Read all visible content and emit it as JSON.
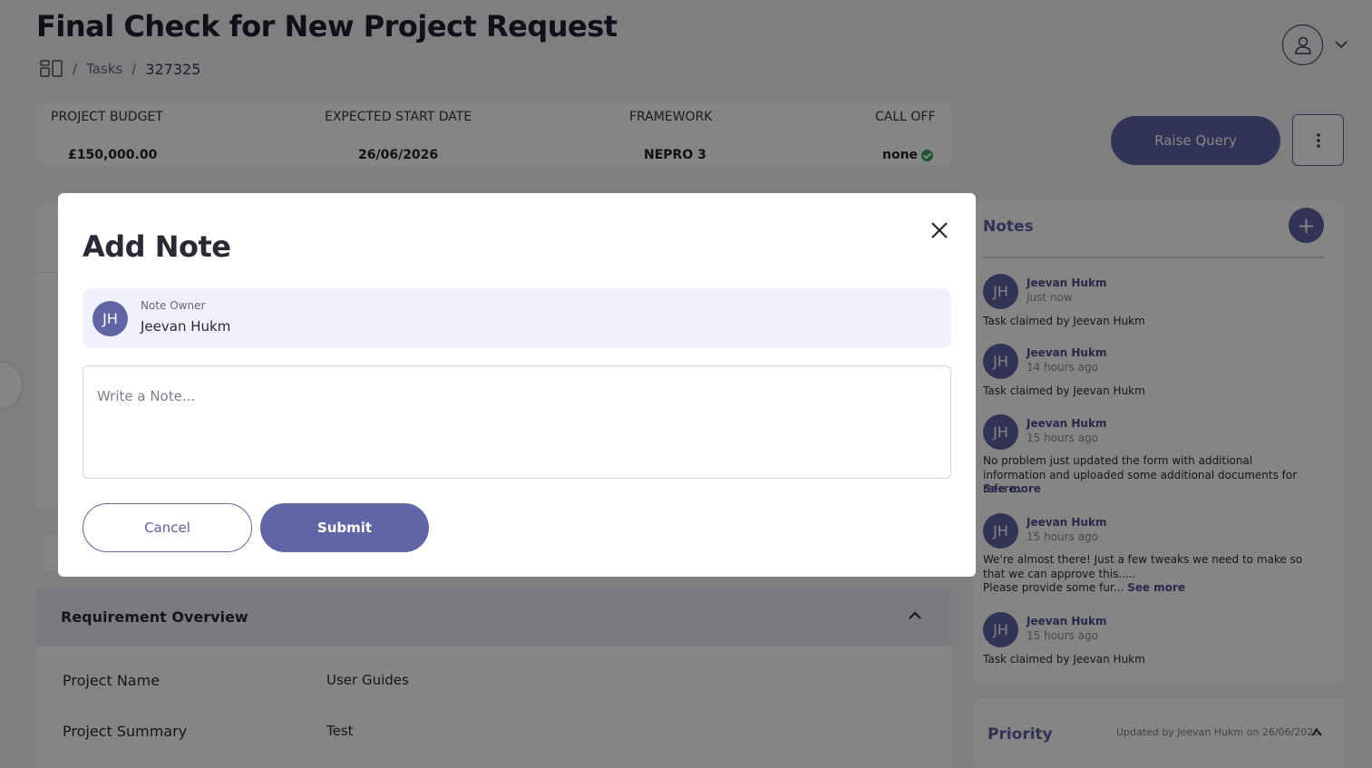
{
  "page": {
    "title": "Final Check for New Project Request",
    "breadcrumb": {
      "home_icon": "dashboard-icon",
      "separator": "/",
      "tasks": "Tasks",
      "id": "327325"
    }
  },
  "header": {
    "profile_icon": "user-icon",
    "menu_icon": "chevron-down-icon"
  },
  "summary": {
    "budget_label": "PROJECT BUDGET",
    "budget_value": "£150,000.00",
    "start_label": "EXPECTED START DATE",
    "start_value": "26/06/2026",
    "framework_label": "FRAMEWORK",
    "framework_value": "NEPRO 3",
    "calloff_label": "CALL OFF",
    "calloff_value": "none",
    "calloff_status_icon": "check-circle-icon"
  },
  "actions": {
    "raise_query": "Raise Query",
    "more_icon": "more-vertical-icon"
  },
  "requirement": {
    "title": "Requirement Overview",
    "rows": [
      {
        "label": "Project Name",
        "value": "User Guides"
      },
      {
        "label": "Project Summary",
        "value": "Test"
      }
    ]
  },
  "notes": {
    "title": "Notes",
    "add_icon": "plus-icon",
    "items": [
      {
        "initials": "JH",
        "name": "Jeevan Hukm",
        "time": "Just now",
        "text": "Task claimed by Jeevan Hukm"
      },
      {
        "initials": "JH",
        "name": "Jeevan Hukm",
        "time": "14 hours ago",
        "text": "Task claimed by Jeevan Hukm"
      },
      {
        "initials": "JH",
        "name": "Jeevan Hukm",
        "time": "15 hours ago",
        "text": "No problem just updated the form with additional information and uploaded some additional documents for refere...",
        "see_more": "See more"
      },
      {
        "initials": "JH",
        "name": "Jeevan Hukm",
        "time": "15 hours ago",
        "text": "We're almost there! Just a few tweaks we need to make so that we can approve this.....",
        "text2": "Please provide some fur...",
        "see_more": "See more"
      },
      {
        "initials": "JH",
        "name": "Jeevan Hukm",
        "time": "15 hours ago",
        "text": "Task claimed by Jeevan Hukm"
      }
    ]
  },
  "priority": {
    "title": "Priority",
    "meta": "Updated by Jeevan Hukm on 26/06/2026"
  },
  "modal": {
    "title": "Add Note",
    "close_icon": "close-icon",
    "owner_label": "Note Owner",
    "owner_name": "Jeevan Hukm",
    "owner_initials": "JH",
    "note_placeholder": "Write a Note...",
    "note_value": "",
    "cancel_label": "Cancel",
    "submit_label": "Submit"
  },
  "colors": {
    "accent": "#6065a5",
    "success": "#2fa84f",
    "overlay": "rgba(0,0,0,0.48)"
  }
}
